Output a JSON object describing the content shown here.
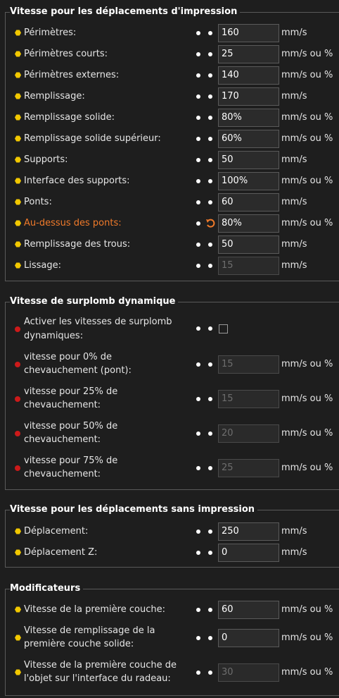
{
  "sections": [
    {
      "title": "Vitesse pour les déplacements d'impression",
      "rows": [
        {
          "label": "Périmètres:",
          "value": "160",
          "unit": "mm/s"
        },
        {
          "label": "Périmètres courts:",
          "value": "25",
          "unit": "mm/s ou %"
        },
        {
          "label": "Périmètres externes:",
          "value": "140",
          "unit": "mm/s ou %"
        },
        {
          "label": "Remplissage:",
          "value": "170",
          "unit": "mm/s"
        },
        {
          "label": "Remplissage solide:",
          "value": "80%",
          "unit": "mm/s ou %"
        },
        {
          "label": "Remplissage solide supérieur:",
          "value": "60%",
          "unit": "mm/s ou %"
        },
        {
          "label": "Supports:",
          "value": "50",
          "unit": "mm/s"
        },
        {
          "label": "Interface des supports:",
          "value": "100%",
          "unit": "mm/s ou %"
        },
        {
          "label": "Ponts:",
          "value": "60",
          "unit": "mm/s"
        },
        {
          "label": "Au-dessus des ponts:",
          "value": "80%",
          "unit": "mm/s ou %"
        },
        {
          "label": "Remplissage des trous:",
          "value": "50",
          "unit": "mm/s"
        },
        {
          "label": "Lissage:",
          "value": "15",
          "unit": "mm/s"
        }
      ]
    },
    {
      "title": "Vitesse de surplomb dynamique",
      "rows": [
        {
          "label1": "Activer les vitesses de surplomb",
          "label2": "dynamiques:"
        },
        {
          "label1": "vitesse pour 0% de",
          "label2": "chevauchement (pont):",
          "value": "15",
          "unit": "mm/s ou %"
        },
        {
          "label1": "vitesse pour 25% de",
          "label2": "chevauchement:",
          "value": "15",
          "unit": "mm/s ou %"
        },
        {
          "label1": "vitesse pour 50% de",
          "label2": "chevauchement:",
          "value": "20",
          "unit": "mm/s ou %"
        },
        {
          "label1": "vitesse pour 75% de",
          "label2": "chevauchement:",
          "value": "25",
          "unit": "mm/s ou %"
        }
      ]
    },
    {
      "title": "Vitesse pour les déplacements sans impression",
      "rows": [
        {
          "label": "Déplacement:",
          "value": "250",
          "unit": "mm/s"
        },
        {
          "label": "Déplacement Z:",
          "value": "0",
          "unit": "mm/s"
        }
      ]
    },
    {
      "title": "Modificateurs",
      "rows": [
        {
          "label": "Vitesse de la première couche:",
          "value": "60",
          "unit": "mm/s ou %"
        },
        {
          "label1": "Vitesse de remplissage de la",
          "label2": "première couche solide:",
          "value": "0",
          "unit": "mm/s ou %"
        },
        {
          "label1": "Vitesse de la première couche de",
          "label2": "l'objet sur l'interface du radeau:",
          "value": "30",
          "unit": "mm/s ou %"
        }
      ]
    }
  ],
  "colors": {
    "hex_bullet": "#f2c800",
    "red_bullet": "#cc1a1a",
    "modified_label": "#f07a2a",
    "background": "#1e1e1e"
  },
  "icons": {
    "lock": "lock-dot-icon",
    "undo": "undo-arrow-icon"
  }
}
